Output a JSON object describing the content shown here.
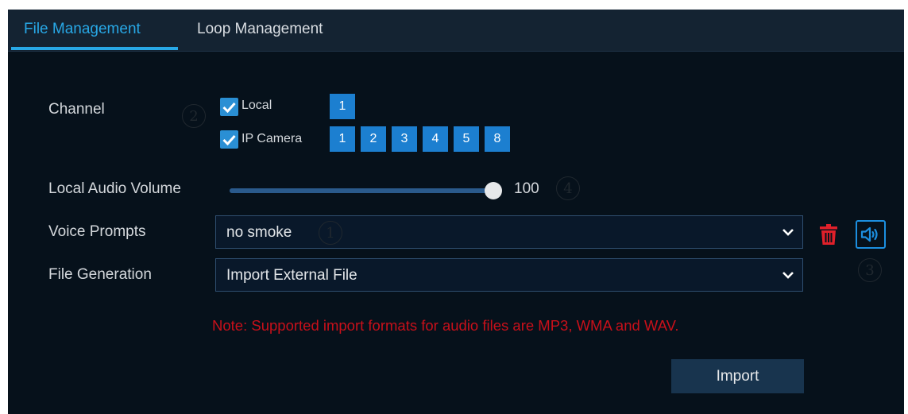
{
  "tabs": [
    {
      "label": "File Management",
      "active": true
    },
    {
      "label": "Loop Management",
      "active": false
    }
  ],
  "channel": {
    "label": "Channel",
    "local": {
      "label": "Local",
      "checked": true,
      "channels": [
        "1"
      ]
    },
    "ip_camera": {
      "label": "IP Camera",
      "checked": true,
      "channels": [
        "1",
        "2",
        "3",
        "4",
        "5",
        "8"
      ]
    }
  },
  "volume": {
    "label": "Local Audio Volume",
    "value": "100",
    "level_percent": 100
  },
  "voice_prompts": {
    "label": "Voice Prompts",
    "selected": "no smoke"
  },
  "file_generation": {
    "label": "File Generation",
    "selected": "Import External File"
  },
  "note": "Note: Supported import formats for audio files are MP3, WMA and WAV.",
  "import_button": "Import",
  "markers": {
    "m1": "1",
    "m2": "2",
    "m3": "3",
    "m4": "4"
  },
  "icons": {
    "trash": "trash-icon",
    "speaker": "speaker-icon",
    "chevron": "chevron-down-icon",
    "check": "checkmark-icon"
  },
  "colors": {
    "accent": "#28a8e6",
    "channel_button": "#1c7fd0",
    "note": "#c8101a",
    "delete": "#e0202a"
  }
}
